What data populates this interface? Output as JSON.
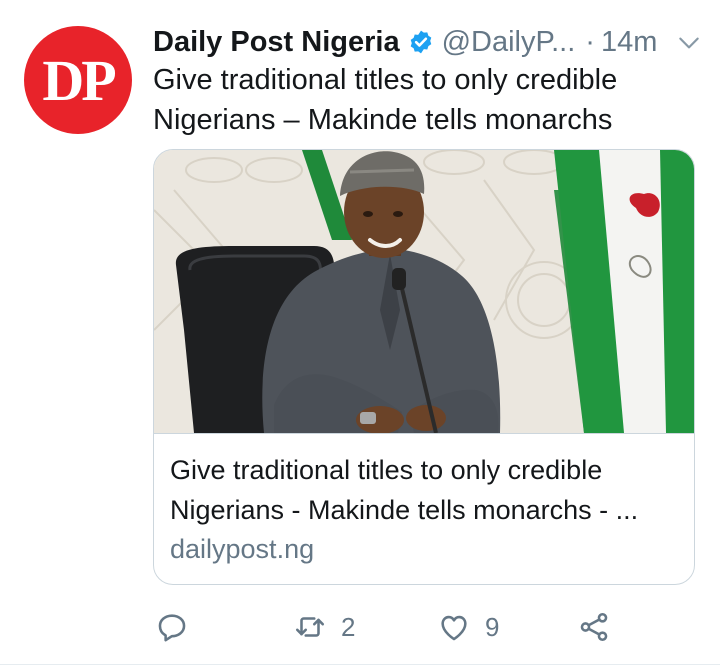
{
  "tweet": {
    "avatar_text": "DP",
    "author_name": "Daily Post Nigeria",
    "handle": "@DailyP...",
    "separator": "·",
    "time": "14m",
    "text": "Give traditional titles to only credible Nigerians – Makinde tells monarchs",
    "verified": true
  },
  "card": {
    "title": "Give traditional titles to only credible Nigerians - Makinde tells monarchs - ...",
    "domain": "dailypost.ng"
  },
  "actions": {
    "reply_count": "",
    "retweet_count": "2",
    "like_count": "9"
  },
  "colors": {
    "avatar_red": "#e8232a",
    "verified_blue": "#1da1f2",
    "muted": "#657786",
    "flag_green": "#1f8a3a"
  },
  "icons": [
    "verified-icon",
    "chevron-down-icon",
    "reply-icon",
    "retweet-icon",
    "like-icon",
    "share-icon"
  ]
}
